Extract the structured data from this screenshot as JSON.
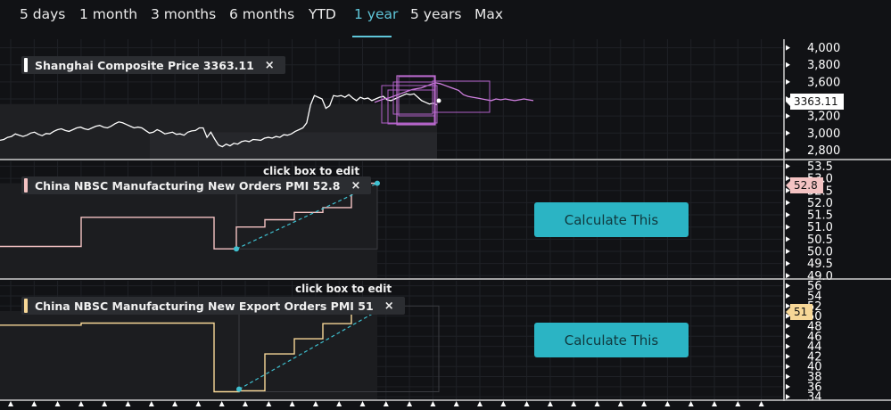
{
  "tabs": [
    {
      "label": "5 days",
      "active": false
    },
    {
      "label": "1 month",
      "active": false
    },
    {
      "label": "3 months",
      "active": false
    },
    {
      "label": "6 months",
      "active": false
    },
    {
      "label": "YTD",
      "active": false
    },
    {
      "label": "1 year",
      "active": true
    },
    {
      "label": "5 years",
      "active": false
    },
    {
      "label": "Max",
      "active": false
    }
  ],
  "colors": {
    "accent": "#5fc6d9",
    "price": "#ffffff",
    "new_orders": "#f4c3c3",
    "export_orders": "#f7d797",
    "drawing": "#c070d0",
    "trend": "#3fc0d0"
  },
  "panels": {
    "price": {
      "legend": "Shanghai Composite Price 3363.11",
      "close": "×",
      "last_label": "3363.11"
    },
    "new_orders": {
      "legend": "China NBSC Manufacturing New Orders PMI 52.8",
      "close": "×",
      "hint": "click box to edit",
      "last_label": "52.8",
      "button": "Calculate This"
    },
    "export_orders": {
      "legend": "China NBSC Manufacturing New Export Orders PMI 51",
      "close": "×",
      "hint": "click box to edit",
      "last_label": "51",
      "button": "Calculate This"
    }
  },
  "chart_data": [
    {
      "type": "line",
      "name": "price",
      "ylim": [
        2700,
        4100
      ],
      "yticks": [
        4000,
        3800,
        3600,
        3400,
        3200,
        3000,
        2800
      ],
      "tick_labels": [
        "4,000",
        "3,800",
        "3,600",
        "3,400",
        "3,200",
        "3,000",
        "2,800"
      ],
      "last_value": 3363.11,
      "series": [
        {
          "name": "Shanghai Composite Price",
          "values": [
            2915,
            2925,
            2950,
            2960,
            2990,
            2975,
            2960,
            2975,
            3000,
            3010,
            2985,
            2970,
            2995,
            2990,
            3020,
            3040,
            3050,
            3030,
            3020,
            3040,
            3060,
            3070,
            3050,
            3040,
            3060,
            3080,
            3090,
            3070,
            3060,
            3080,
            3110,
            3130,
            3120,
            3100,
            3080,
            3060,
            3070,
            3060,
            3030,
            3000,
            3010,
            3040,
            3020,
            2990,
            3000,
            3010,
            2985,
            2990,
            2975,
            3010,
            3025,
            3030,
            3060,
            3060,
            2950,
            3010,
            2930,
            2860,
            2840,
            2870,
            2850,
            2880,
            2870,
            2900,
            2910,
            2900,
            2925,
            2920,
            2915,
            2940,
            2950,
            2940,
            2960,
            2950,
            2980,
            2975,
            2990,
            3020,
            3040,
            3060,
            3120,
            3330,
            3440,
            3420,
            3400,
            3290,
            3320,
            3440,
            3430,
            3440,
            3420,
            3450,
            3410,
            3380,
            3420,
            3400,
            3410,
            3380,
            3400,
            3420,
            3430,
            3390,
            3380,
            3400,
            3420,
            3440,
            3460,
            3450,
            3460,
            3420,
            3380,
            3360,
            3340,
            3350,
            3330
          ]
        },
        {
          "name": "projection",
          "values": [
            3360,
            3380,
            3400,
            3410,
            3430,
            3450,
            3470,
            3490,
            3510,
            3520,
            3530,
            3550,
            3570,
            3590,
            3580,
            3560,
            3540,
            3520,
            3500,
            3450,
            3430,
            3420,
            3410,
            3400,
            3390,
            3380,
            3400,
            3390,
            3400,
            3390,
            3380,
            3390,
            3400,
            3390,
            3380
          ]
        }
      ]
    },
    {
      "type": "line",
      "name": "new_orders",
      "ylim": [
        48.9,
        53.7
      ],
      "yticks": [
        53.5,
        53.0,
        52.5,
        52.0,
        51.5,
        51.0,
        50.5,
        50.0,
        49.5,
        49.0
      ],
      "tick_labels": [
        "53.5",
        "53.0",
        "52.5",
        "52.0",
        "51.5",
        "51.0",
        "50.5",
        "50.0",
        "49.5",
        "49.0"
      ],
      "last_value": 52.8,
      "series": [
        {
          "name": "China NBSC Manufacturing New Orders PMI",
          "values": [
            50.2,
            50.2,
            51.4,
            51.4,
            51.6,
            51.6,
            51.7,
            51.7,
            51.7,
            51.7,
            50.1,
            50.1,
            51.0,
            51.0,
            51.3,
            51.3,
            51.6,
            51.6,
            51.8,
            51.8,
            52.3,
            52.3,
            52.8,
            52.8
          ]
        }
      ]
    },
    {
      "type": "line",
      "name": "export_orders",
      "ylim": [
        33.5,
        57
      ],
      "yticks": [
        56,
        54,
        52,
        50,
        48,
        46,
        44,
        42,
        40,
        38,
        36,
        34
      ],
      "tick_labels": [
        "56",
        "54",
        "52",
        "50",
        "48",
        "46",
        "44",
        "42",
        "40",
        "38",
        "36",
        "34"
      ],
      "last_value": 51,
      "series": [
        {
          "name": "China NBSC Manufacturing New Export Orders PMI",
          "values": [
            48.2,
            48.2,
            48.6,
            48.6,
            48.6,
            48.6,
            48.7,
            48.7,
            48.7,
            48.7,
            35.0,
            35.0,
            35.2,
            35.2,
            42.5,
            42.5,
            45.5,
            45.5,
            48.5,
            48.5,
            50.5,
            50.5,
            51.0,
            51.0
          ]
        }
      ]
    }
  ]
}
